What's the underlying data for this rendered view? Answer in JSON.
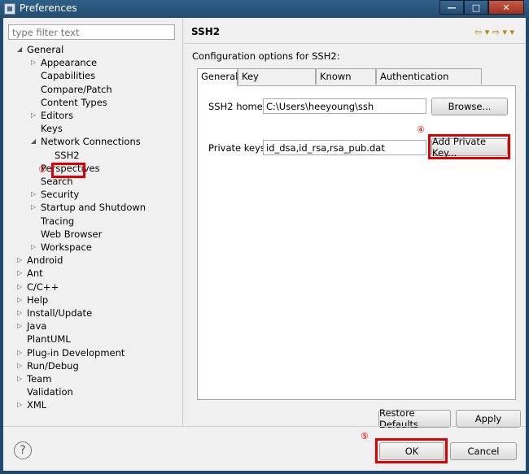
{
  "window": {
    "title": "Preferences",
    "controls": {
      "minimize": "—",
      "maximize": "□",
      "close": "✕"
    }
  },
  "filter": {
    "placeholder": "type filter text"
  },
  "tree": [
    {
      "label": "General",
      "arrow": "◢"
    },
    {
      "label": "Appearance",
      "arrow": "▷"
    },
    {
      "label": "Capabilities",
      "arrow": ""
    },
    {
      "label": "Compare/Patch",
      "arrow": ""
    },
    {
      "label": "Content Types",
      "arrow": ""
    },
    {
      "label": "Editors",
      "arrow": "▷"
    },
    {
      "label": "Keys",
      "arrow": ""
    },
    {
      "label": "Network Connections",
      "arrow": "◢"
    },
    {
      "label": "SSH2",
      "arrow": ""
    },
    {
      "label": "Perspectives",
      "arrow": ""
    },
    {
      "label": "Search",
      "arrow": ""
    },
    {
      "label": "Security",
      "arrow": "▷"
    },
    {
      "label": "Startup and Shutdown",
      "arrow": "▷"
    },
    {
      "label": "Tracing",
      "arrow": ""
    },
    {
      "label": "Web Browser",
      "arrow": ""
    },
    {
      "label": "Workspace",
      "arrow": "▷"
    },
    {
      "label": "Android",
      "arrow": "▷"
    },
    {
      "label": "Ant",
      "arrow": "▷"
    },
    {
      "label": "C/C++",
      "arrow": "▷"
    },
    {
      "label": "Help",
      "arrow": "▷"
    },
    {
      "label": "Install/Update",
      "arrow": "▷"
    },
    {
      "label": "Java",
      "arrow": "▷"
    },
    {
      "label": "PlantUML",
      "arrow": ""
    },
    {
      "label": "Plug-in Development",
      "arrow": "▷"
    },
    {
      "label": "Run/Debug",
      "arrow": "▷"
    },
    {
      "label": "Team",
      "arrow": "▷"
    },
    {
      "label": "Validation",
      "arrow": ""
    },
    {
      "label": "XML",
      "arrow": "▷"
    }
  ],
  "page": {
    "title": "SSH2",
    "nav": "⇦ ▾ ⇨ ▾ ▾",
    "description": "Configuration options for SSH2:"
  },
  "tabs": [
    "General",
    "Key Management",
    "Known Hosts",
    "Authentication Methods"
  ],
  "general": {
    "ssh2_home_label": "SSH2 home:",
    "ssh2_home_value": "C:\\Users\\heeyoung\\ssh",
    "browse": "Browse...",
    "private_keys_label": "Private keys:",
    "private_keys_value": "id_dsa,id_rsa,rsa_pub.dat",
    "add_private_key": "Add Private Key..."
  },
  "buttons": {
    "restore_defaults": "Restore Defaults",
    "apply": "Apply",
    "ok": "OK",
    "cancel": "Cancel",
    "help": "?"
  },
  "annotations": {
    "step3": "③",
    "step4": "④",
    "step5": "⑤"
  },
  "colors": {
    "highlight": "#e00000",
    "title_bar": "#2f5f88"
  }
}
